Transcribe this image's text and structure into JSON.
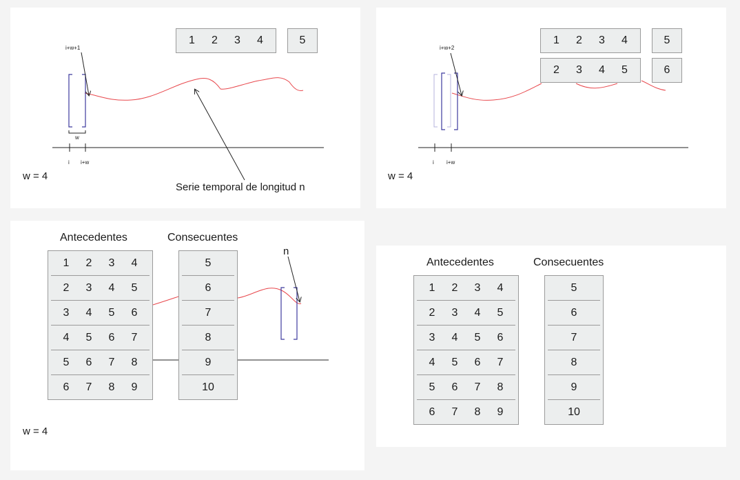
{
  "panel1": {
    "window_top": [
      "1",
      "2",
      "3",
      "4"
    ],
    "target_top": "5",
    "marker_label": "i+w+1",
    "w_label": "w",
    "tick_i": "i",
    "tick_iw": "i+w",
    "w_eq": "w = 4",
    "series_label": "Serie temporal de longitud n"
  },
  "panel2": {
    "window_rows": [
      [
        "1",
        "2",
        "3",
        "4"
      ],
      [
        "2",
        "3",
        "4",
        "5"
      ]
    ],
    "targets": [
      "5",
      "6"
    ],
    "marker_label": "i+w+2",
    "tick_i": "i",
    "tick_iw": "i+w",
    "w_eq": "w = 4"
  },
  "panel3": {
    "antecedents_header": "Antecedentes",
    "consequents_header": "Consecuentes",
    "antecedents": [
      [
        "1",
        "2",
        "3",
        "4"
      ],
      [
        "2",
        "3",
        "4",
        "5"
      ],
      [
        "3",
        "4",
        "5",
        "6"
      ],
      [
        "4",
        "5",
        "6",
        "7"
      ],
      [
        "5",
        "6",
        "7",
        "8"
      ],
      [
        "6",
        "7",
        "8",
        "9"
      ]
    ],
    "consequents": [
      "5",
      "6",
      "7",
      "8",
      "9",
      "10"
    ],
    "n_label": "n",
    "w_eq": "w = 4"
  },
  "panel4": {
    "antecedents_header": "Antecedentes",
    "consequents_header": "Consecuentes",
    "antecedents": [
      [
        "1",
        "2",
        "3",
        "4"
      ],
      [
        "2",
        "3",
        "4",
        "5"
      ],
      [
        "3",
        "4",
        "5",
        "6"
      ],
      [
        "4",
        "5",
        "6",
        "7"
      ],
      [
        "5",
        "6",
        "7",
        "8"
      ],
      [
        "6",
        "7",
        "8",
        "9"
      ]
    ],
    "consequents": [
      "5",
      "6",
      "7",
      "8",
      "9",
      "10"
    ]
  },
  "colors": {
    "series": "#e8474c",
    "window_bracket": "#3d3a9e",
    "box_fill": "#eceeee",
    "box_border": "#9a9a9a"
  }
}
